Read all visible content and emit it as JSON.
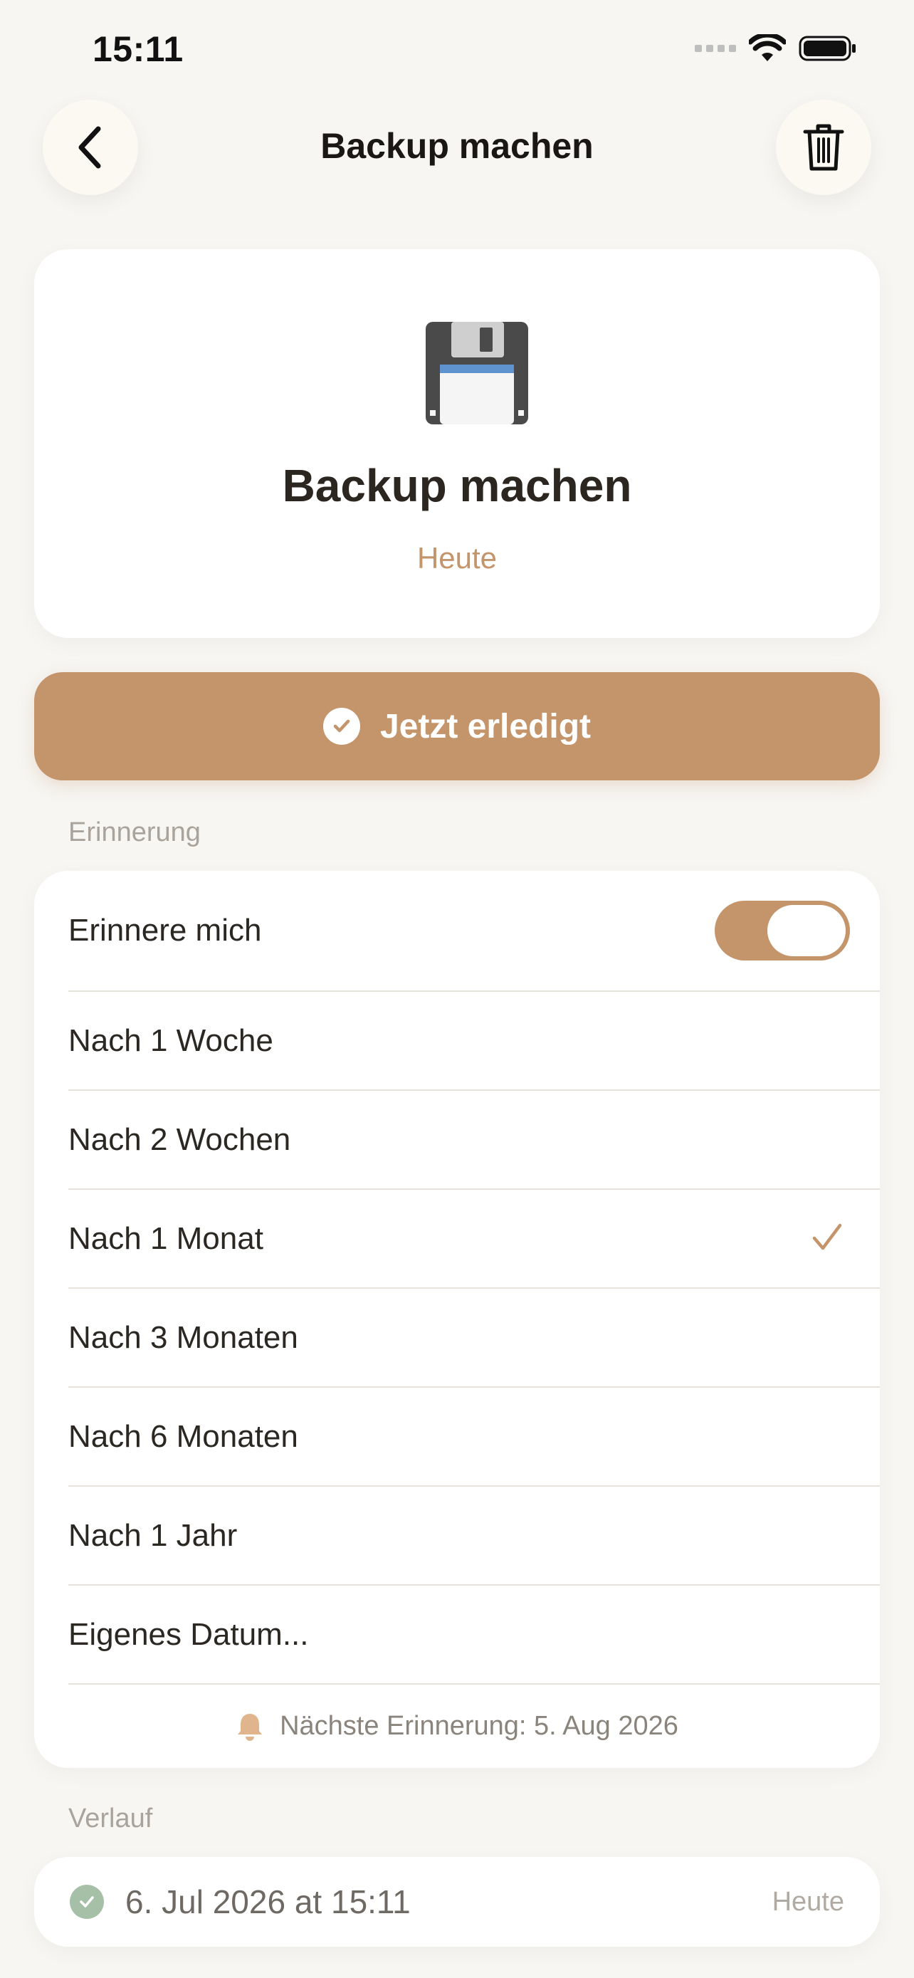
{
  "status_bar": {
    "time": "15:11"
  },
  "nav": {
    "title": "Backup machen",
    "back_icon": "chevron-left-icon",
    "trash_icon": "trash-icon"
  },
  "hero": {
    "icon": "floppy-disk-icon",
    "title": "Backup machen",
    "subtitle": "Heute"
  },
  "done_button": {
    "label": "Jetzt erledigt"
  },
  "reminder": {
    "section_label": "Erinnerung",
    "toggle_label": "Erinnere mich",
    "toggle_on": true,
    "options": [
      {
        "label": "Nach 1 Woche",
        "selected": false
      },
      {
        "label": "Nach 2 Wochen",
        "selected": false
      },
      {
        "label": "Nach 1 Monat",
        "selected": true
      },
      {
        "label": "Nach 3 Monaten",
        "selected": false
      },
      {
        "label": "Nach 6 Monaten",
        "selected": false
      },
      {
        "label": "Nach 1 Jahr",
        "selected": false
      },
      {
        "label": "Eigenes Datum...",
        "selected": false
      }
    ],
    "next_reminder": "Nächste Erinnerung: 5. Aug 2026"
  },
  "history": {
    "section_label": "Verlauf",
    "entries": [
      {
        "date": "6. Jul 2026 at 15:11",
        "tag": "Heute"
      }
    ]
  },
  "colors": {
    "accent": "#c4946b",
    "background": "#f7f6f3",
    "history_check": "#a6c0a8"
  }
}
